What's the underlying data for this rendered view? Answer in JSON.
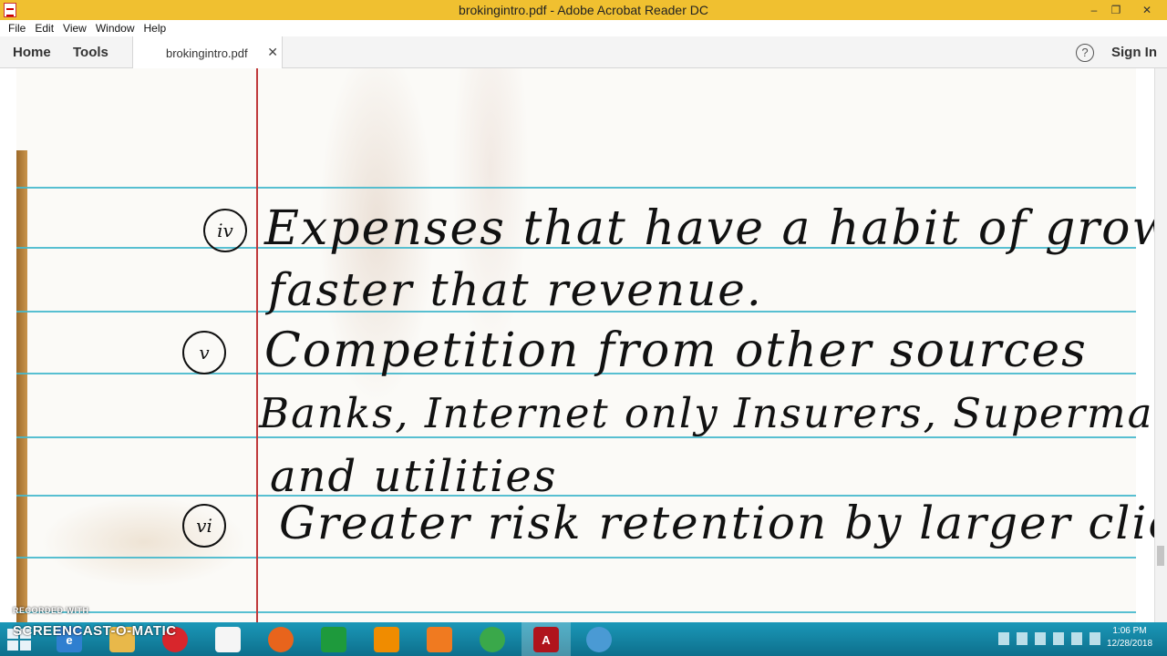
{
  "window": {
    "title": "brokingintro.pdf - Adobe Acrobat Reader DC",
    "minimize": "‒",
    "maximize": "❐",
    "close": "✕"
  },
  "menu": [
    "File",
    "Edit",
    "View",
    "Window",
    "Help"
  ],
  "tabs": {
    "home": "Home",
    "tools": "Tools",
    "document": "brokingintro.pdf",
    "close": "✕",
    "help": "?",
    "sign_in": "Sign In"
  },
  "document": {
    "lines": [
      "Expenses that have a habit of growing",
      "faster that revenue.",
      "Competition from other sources",
      "Banks, Internet only Insurers, Supermarkets",
      "and utilities",
      "Greater risk retention by larger clients"
    ],
    "bullets": [
      "iv",
      "v",
      "vi"
    ]
  },
  "recording": {
    "recorded_with": "RECORDED WITH",
    "brand": "SCREENCAST-O-MATIC"
  },
  "taskbar": {
    "icons": [
      "windows-start-icon",
      "ie-icon",
      "file-explorer-icon",
      "opera-icon",
      "documents-icon",
      "firefox-icon",
      "store-icon",
      "vlc-icon",
      "xampp-icon",
      "chrome-icon",
      "acrobat-icon",
      "screencast-icon"
    ],
    "time": "1:06 PM",
    "date": "12/28/2018"
  },
  "colors": {
    "titlebar": "#f0c030",
    "rule_line": "#45b8cc",
    "margin_line": "#c0393b",
    "taskbar": "#1b98b8"
  }
}
